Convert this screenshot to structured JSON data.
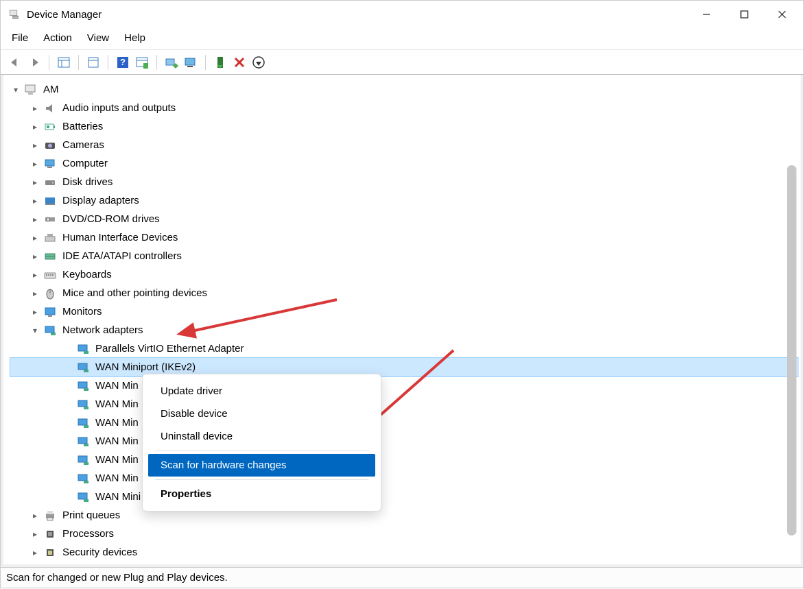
{
  "window": {
    "title": "Device Manager"
  },
  "menu": {
    "file": "File",
    "action": "Action",
    "view": "View",
    "help": "Help"
  },
  "tree": {
    "root": "AM",
    "categories": [
      "Audio inputs and outputs",
      "Batteries",
      "Cameras",
      "Computer",
      "Disk drives",
      "Display adapters",
      "DVD/CD-ROM drives",
      "Human Interface Devices",
      "IDE ATA/ATAPI controllers",
      "Keyboards",
      "Mice and other pointing devices",
      "Monitors",
      "Network adapters",
      "Print queues",
      "Processors",
      "Security devices"
    ],
    "network_adapters": [
      "Parallels VirtIO Ethernet Adapter",
      "WAN Miniport (IKEv2)",
      "WAN Min",
      "WAN Min",
      "WAN Min",
      "WAN Min",
      "WAN Min",
      "WAN Min",
      "WAN Mini"
    ]
  },
  "context": {
    "update": "Update driver",
    "disable": "Disable device",
    "uninstall": "Uninstall device",
    "scan": "Scan for hardware changes",
    "properties": "Properties"
  },
  "status": "Scan for changed or new Plug and Play devices.",
  "icons": {
    "computer": "computer-icon"
  }
}
